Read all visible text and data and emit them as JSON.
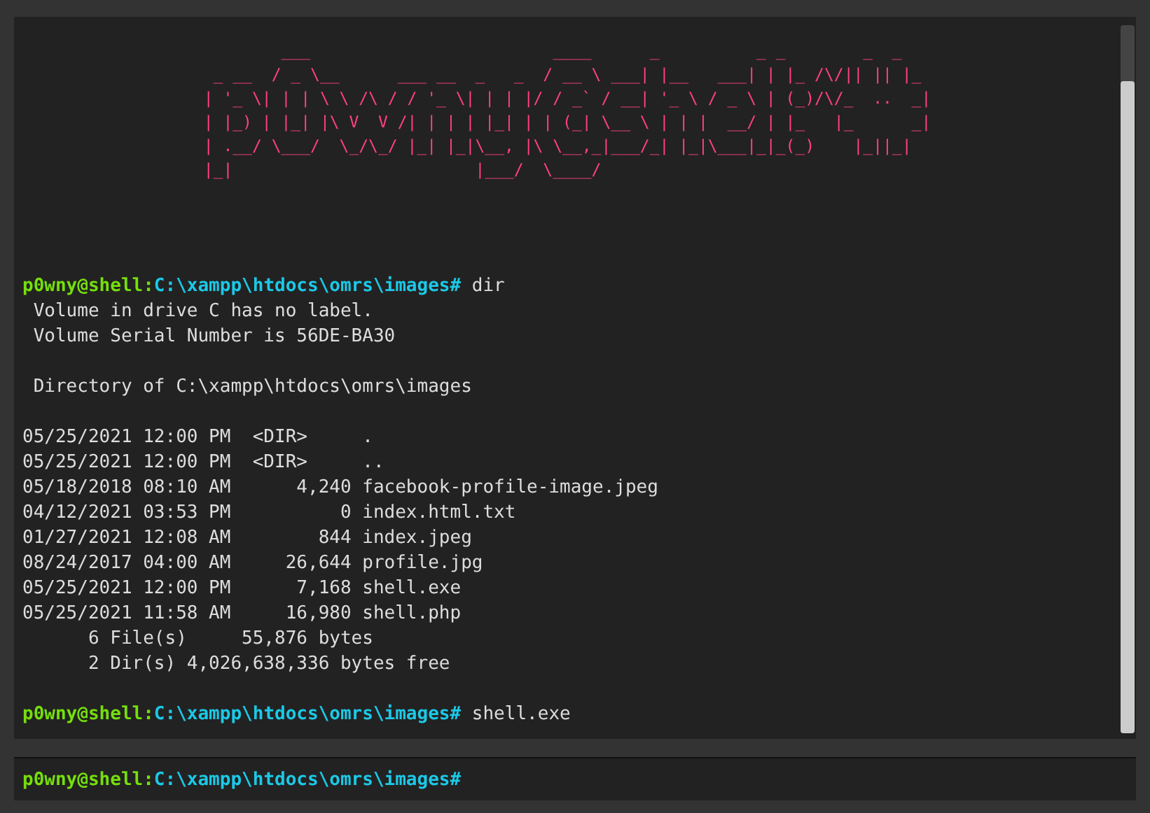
{
  "banner": "        ___                         ____      _          _ _        _  _   \n _ __  / _ \\__      ___ __  _   _  / __ \\ ___| |__   ___| | |_ /\\/|| || |_ \n| '_ \\| | | \\ \\ /\\ / / '_ \\| | | |/ / _` / __| '_ \\ / _ \\ | (_)/\\/_  ..  _|\n| |_) | |_| |\\ V  V /| | | | |_| | | (_| \\__ \\ | | |  __/ | |_   |_      _|\n| .__/ \\___/  \\_/\\_/ |_| |_|\\__, |\\ \\__,_|___/_| |_|\\___|_|_(_)    |_||_|  \n|_|                         |___/  \\____/                                  ",
  "history": [
    {
      "kind": "prompt",
      "user": "p0wny@shell:",
      "cwd": "C:\\xampp\\htdocs\\omrs\\images#",
      "command": "dir"
    },
    {
      "kind": "output",
      "paragraphs": [
        [
          " Volume in drive C has no label.",
          " Volume Serial Number is 56DE-BA30"
        ],
        [
          " Directory of C:\\xampp\\htdocs\\omrs\\images"
        ],
        [
          "05/25/2021 12:00 PM  <DIR>     .",
          "05/25/2021 12:00 PM  <DIR>     ..",
          "05/18/2018 08:10 AM      4,240 facebook-profile-image.jpeg",
          "04/12/2021 03:53 PM          0 index.html.txt",
          "01/27/2021 12:08 AM        844 index.jpeg",
          "08/24/2017 04:00 AM     26,644 profile.jpg",
          "05/25/2021 12:00 PM      7,168 shell.exe",
          "05/25/2021 11:58 AM     16,980 shell.php",
          "      6 File(s)     55,876 bytes",
          "      2 Dir(s) 4,026,638,336 bytes free"
        ]
      ]
    },
    {
      "kind": "prompt",
      "user": "p0wny@shell:",
      "cwd": "C:\\xampp\\htdocs\\omrs\\images#",
      "command": "shell.exe"
    }
  ],
  "input": {
    "user": "p0wny@shell:",
    "cwd": "C:\\xampp\\htdocs\\omrs\\images#"
  }
}
